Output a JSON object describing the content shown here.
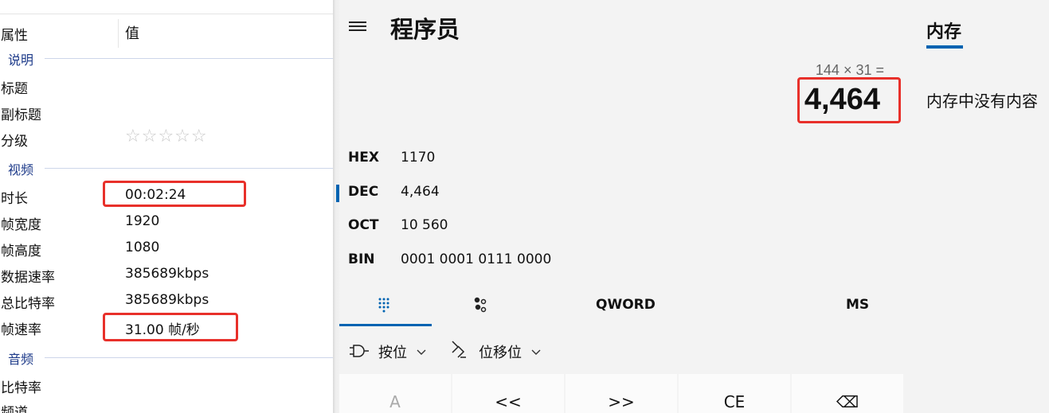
{
  "properties": {
    "header": {
      "name_col": "属性",
      "value_col": "值"
    },
    "groups": {
      "description": "说明",
      "video": "视频",
      "audio": "音频"
    },
    "description_rows": [
      {
        "name": "标题",
        "value": ""
      },
      {
        "name": "副标题",
        "value": ""
      },
      {
        "name": "分级",
        "value": "☆☆☆☆☆"
      }
    ],
    "video_rows": [
      {
        "name": "时长",
        "value": "00:02:24"
      },
      {
        "name": "帧宽度",
        "value": "1920"
      },
      {
        "name": "帧高度",
        "value": "1080"
      },
      {
        "name": "数据速率",
        "value": "385689kbps"
      },
      {
        "name": "总比特率",
        "value": "385689kbps"
      },
      {
        "name": "帧速率",
        "value": "31.00 帧/秒"
      }
    ],
    "audio_rows": [
      {
        "name": "比特率",
        "value": ""
      },
      {
        "name": "频道",
        "value": ""
      }
    ],
    "rating_stars_filled": 0,
    "rating_stars_total": 5
  },
  "calculator": {
    "mode_title": "程序员",
    "expression": "144 × 31 =",
    "result": "4,464",
    "radix": [
      {
        "name": "HEX",
        "value": "1170"
      },
      {
        "name": "DEC",
        "value": "4,464"
      },
      {
        "name": "OCT",
        "value": "10 560"
      },
      {
        "name": "BIN",
        "value": "0001 0001 0111 0000"
      }
    ],
    "active_radix": "DEC",
    "tabs": {
      "word_size": "QWORD",
      "memory_store": "MS"
    },
    "dropdowns": {
      "bitwise": "按位",
      "bitshift": "位移位"
    },
    "keys": [
      "A",
      "<<",
      ">>",
      "CE",
      "⌫"
    ],
    "memory": {
      "title": "内存",
      "empty_text": "内存中没有内容"
    },
    "accent_color": "#0063b1"
  },
  "highlight_color": "#e8302a"
}
